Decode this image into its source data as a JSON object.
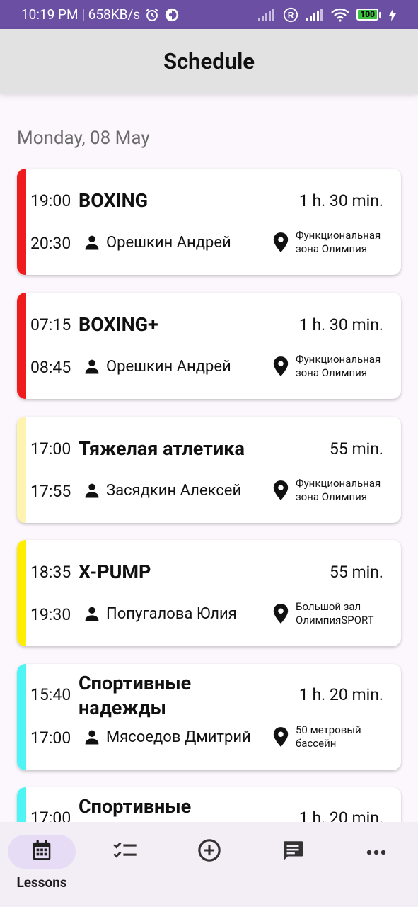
{
  "status_bar": {
    "time_speed": "10:19 PM | 658KB/s",
    "battery": "100"
  },
  "app_bar": {
    "title": "Schedule"
  },
  "date_header": "Monday, 08 May",
  "lessons": [
    {
      "start": "19:00",
      "end": "20:30",
      "title": "BOXING",
      "duration": "1 h. 30 min.",
      "trainer": "Орешкин Андрей",
      "place": "Функциональная зона Олимпия",
      "color": "#ee1c1c"
    },
    {
      "start": "07:15",
      "end": "08:45",
      "title": "BOXING+",
      "duration": "1 h. 30 min.",
      "trainer": "Орешкин Андрей",
      "place": "Функциональная зона Олимпия",
      "color": "#ee1c1c"
    },
    {
      "start": "17:00",
      "end": "17:55",
      "title": "Тяжелая атлетика",
      "duration": "55 min.",
      "trainer": "Засядкин Алексей",
      "place": "Функциональная зона Олимпия",
      "color": "#fff3b0"
    },
    {
      "start": "18:35",
      "end": "19:30",
      "title": "X-PUMP",
      "duration": "55 min.",
      "trainer": "Попугалова Юлия",
      "place": "Большой зал ОлимпияSPORT",
      "color": "#ffee00"
    },
    {
      "start": "15:40",
      "end": "17:00",
      "title": "Спортивные надежды",
      "duration": "1 h. 20 min.",
      "trainer": "Мясоедов Дмитрий",
      "place": "50 метровый бассейн",
      "color": "#4ff5f5"
    },
    {
      "start": "17:00",
      "end": "",
      "title": "Спортивные",
      "duration": "1 h. 20 min.",
      "trainer": "",
      "place": "",
      "color": "#4ff5f5"
    }
  ],
  "bottom_nav": {
    "items": [
      {
        "label": "Lessons",
        "icon": "calendar-icon",
        "active": true
      },
      {
        "label": "",
        "icon": "checklist-icon",
        "active": false
      },
      {
        "label": "",
        "icon": "add-circle-icon",
        "active": false
      },
      {
        "label": "",
        "icon": "chat-icon",
        "active": false
      },
      {
        "label": "",
        "icon": "more-icon",
        "active": false
      }
    ]
  }
}
